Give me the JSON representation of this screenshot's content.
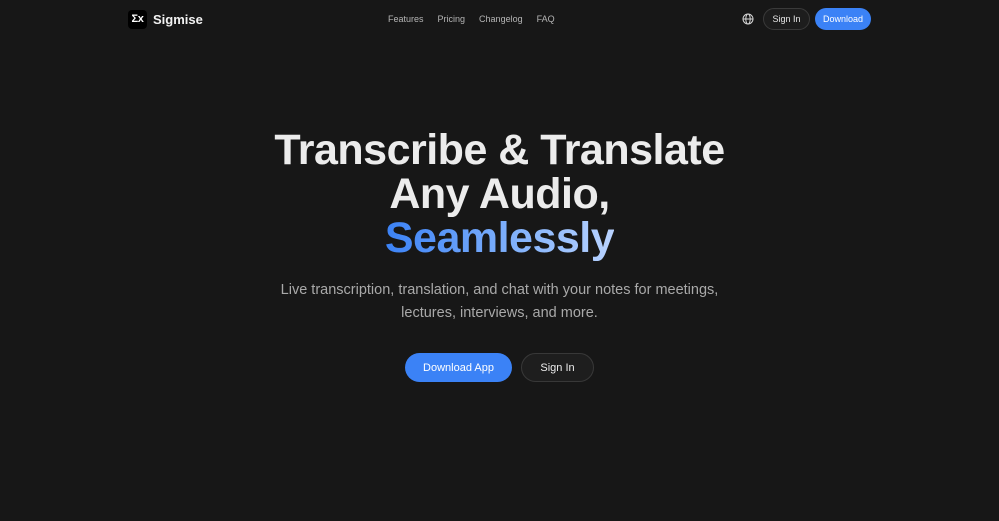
{
  "brand": {
    "logo_text": "Σx",
    "name": "Sigmise"
  },
  "nav": {
    "links": [
      "Features",
      "Pricing",
      "Changelog",
      "FAQ"
    ],
    "language_icon": "globe-icon",
    "signin_label": "Sign In",
    "download_label": "Download"
  },
  "hero": {
    "title_line1": "Transcribe & Translate",
    "title_line2": "Any Audio,",
    "title_accent": "Seamlessly",
    "subtitle_line1": "Live transcription, translation, and chat with your notes for meetings,",
    "subtitle_line2": "lectures, interviews, and more.",
    "primary_cta": "Download App",
    "secondary_cta": "Sign In"
  },
  "colors": {
    "background": "#171717",
    "accent": "#3b82f6",
    "text": "#ececec",
    "muted": "#a9a9a9"
  }
}
